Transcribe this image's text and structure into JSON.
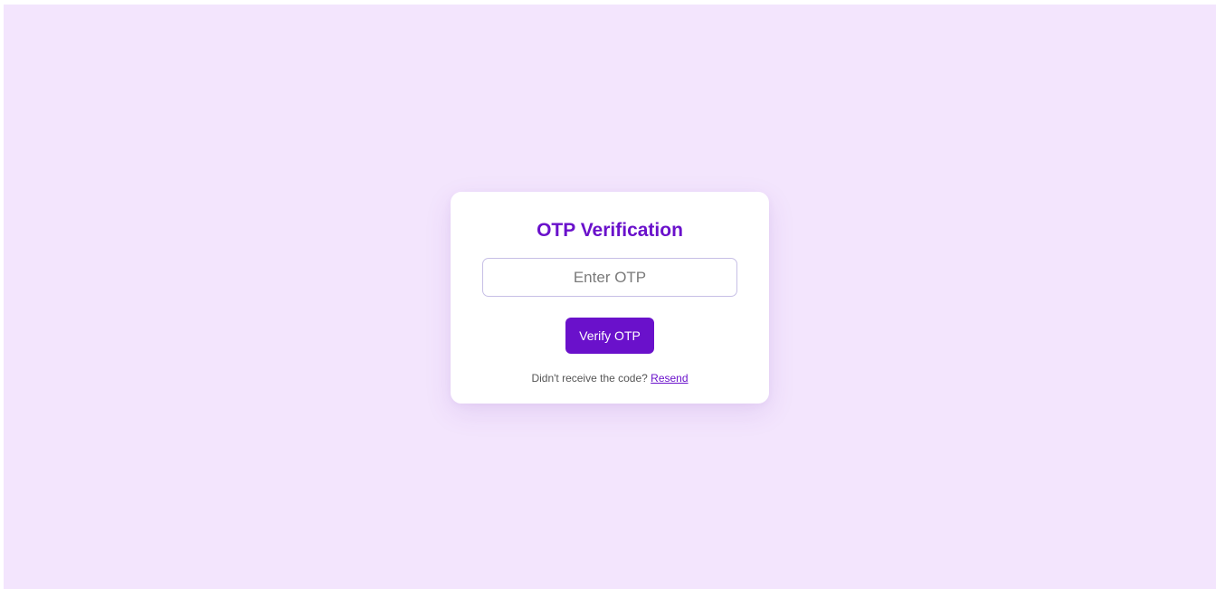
{
  "colors": {
    "background": "#f3e5fd",
    "card": "#ffffff",
    "accent": "#6a11cb",
    "muted_text": "#555555"
  },
  "card": {
    "title": "OTP Verification",
    "otp_input": {
      "value": "",
      "placeholder": "Enter OTP"
    },
    "verify_button_label": "Verify OTP",
    "resend_prompt": "Didn't receive the code?",
    "resend_link_label": "Resend"
  }
}
